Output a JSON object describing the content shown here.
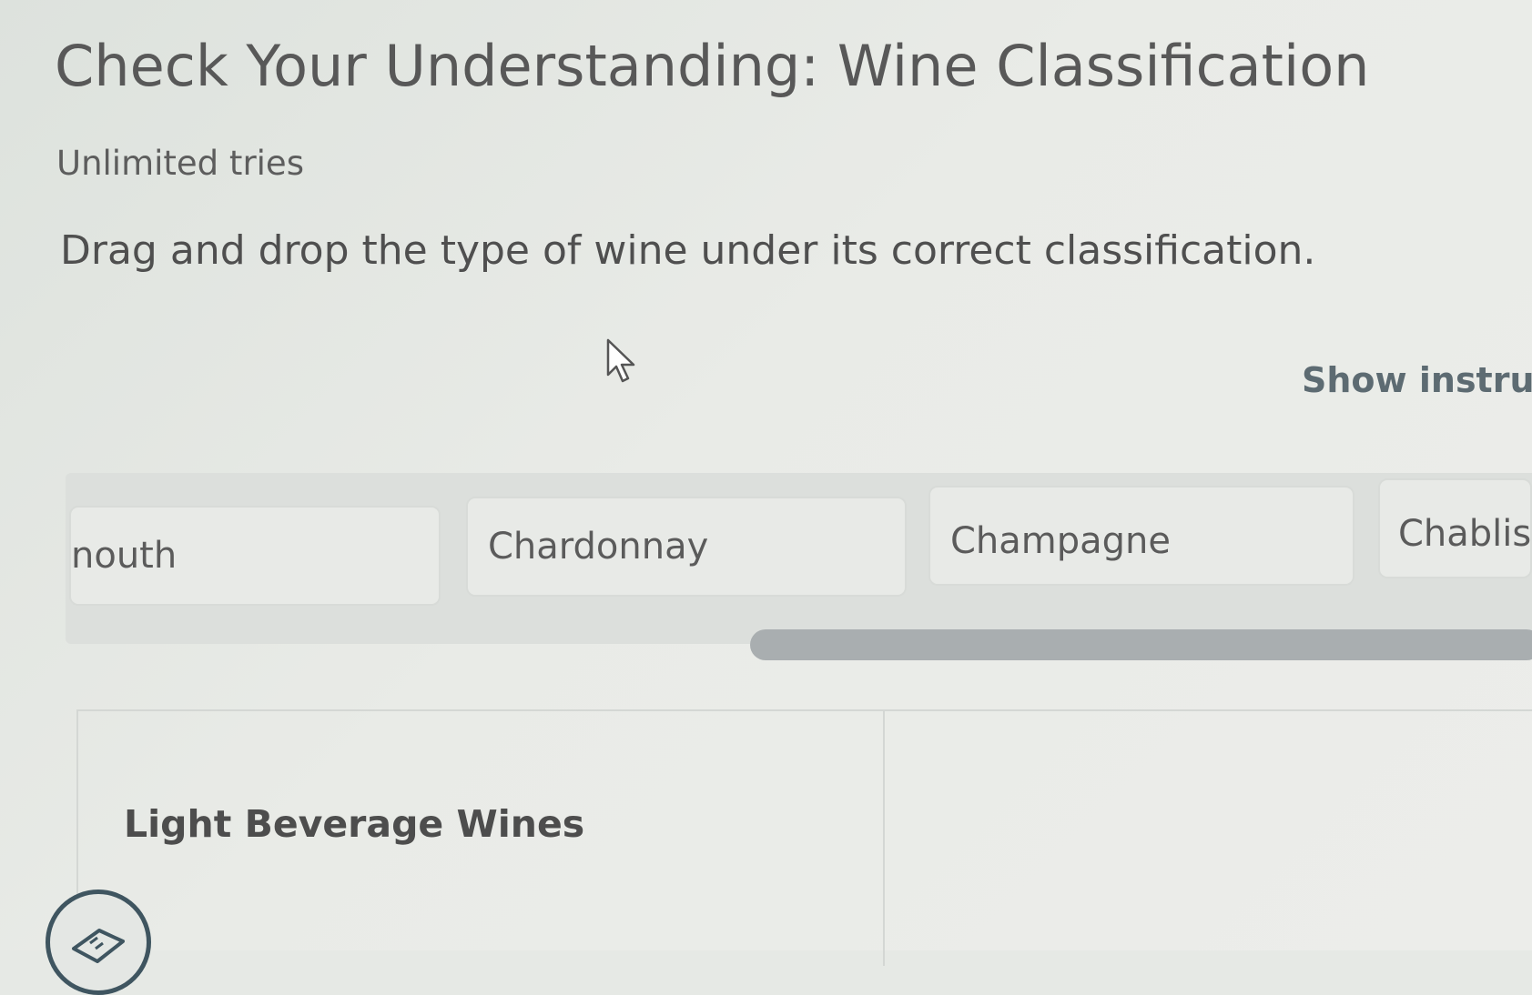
{
  "header": {
    "title": "Check Your Understanding: Wine Classification",
    "tries": "Unlimited tries",
    "instructions": "Drag and drop the type of wine under its correct classification."
  },
  "links": {
    "show_instructions": "Show instructi"
  },
  "word_bank": {
    "items": [
      {
        "label": "nouth"
      },
      {
        "label": "Chardonnay"
      },
      {
        "label": "Champagne"
      },
      {
        "label": "Chablis"
      }
    ]
  },
  "categories": [
    {
      "heading": "Light Beverage Wines"
    },
    {
      "heading": ""
    }
  ],
  "icons": {
    "cursor": "mouse-pointer-icon",
    "help": "note-icon"
  },
  "colors": {
    "title_text": "#585858",
    "link_text": "#5d6b72",
    "scrollbar": "#a9aeb0",
    "badge_border": "#3f5560"
  }
}
